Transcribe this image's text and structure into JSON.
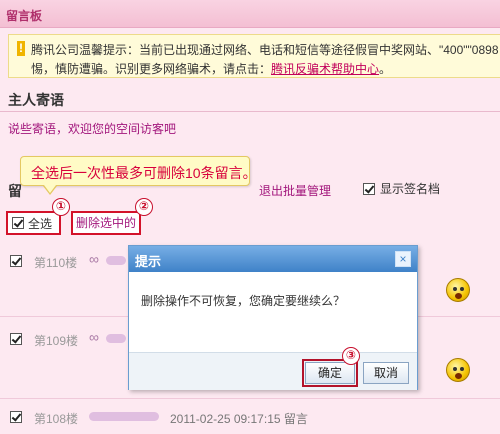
{
  "app": {
    "title": "留言板"
  },
  "notice": {
    "line1": "腾讯公司温馨提示：当前已出现通过网络、电话和短信等途径假冒中奖网站、\"400\"\"0898",
    "line2_prefix": "惕，慎防遭骗。识别更多网络骗术，请点击：",
    "line2_link": "腾讯反骗术帮助中心",
    "line2_suffix": "。"
  },
  "host": {
    "section_title": "主人寄语",
    "message": "说些寄语，欢迎您的空间访客吧"
  },
  "toolbar": {
    "board_label": "留",
    "exit_batch": "退出批量管理",
    "show_signature": "显示签名档",
    "show_signature_checked": true
  },
  "tooltip": {
    "text": "全选后一次性最多可删除10条留言。"
  },
  "actions": {
    "select_all": "全选",
    "select_all_checked": true,
    "delete_selected": "删除选中的"
  },
  "steps": {
    "one": "①",
    "two": "②",
    "three": "③"
  },
  "messages": [
    {
      "floor": "第110楼",
      "symbol": "∞",
      "checked": true
    },
    {
      "floor": "第109楼",
      "symbol": "∞",
      "checked": true
    },
    {
      "floor": "第108楼",
      "symbol": "",
      "checked": true,
      "time": "2011-02-25 09:17:15 留言"
    }
  ],
  "dialog": {
    "title": "提示",
    "close": "×",
    "message": "删除操作不可恢复，您确定要继续么？",
    "ok": "确定",
    "cancel": "取消"
  },
  "colors": {
    "accent": "#a2167c",
    "highlight": "#d3122a",
    "background": "#fde9f1"
  }
}
